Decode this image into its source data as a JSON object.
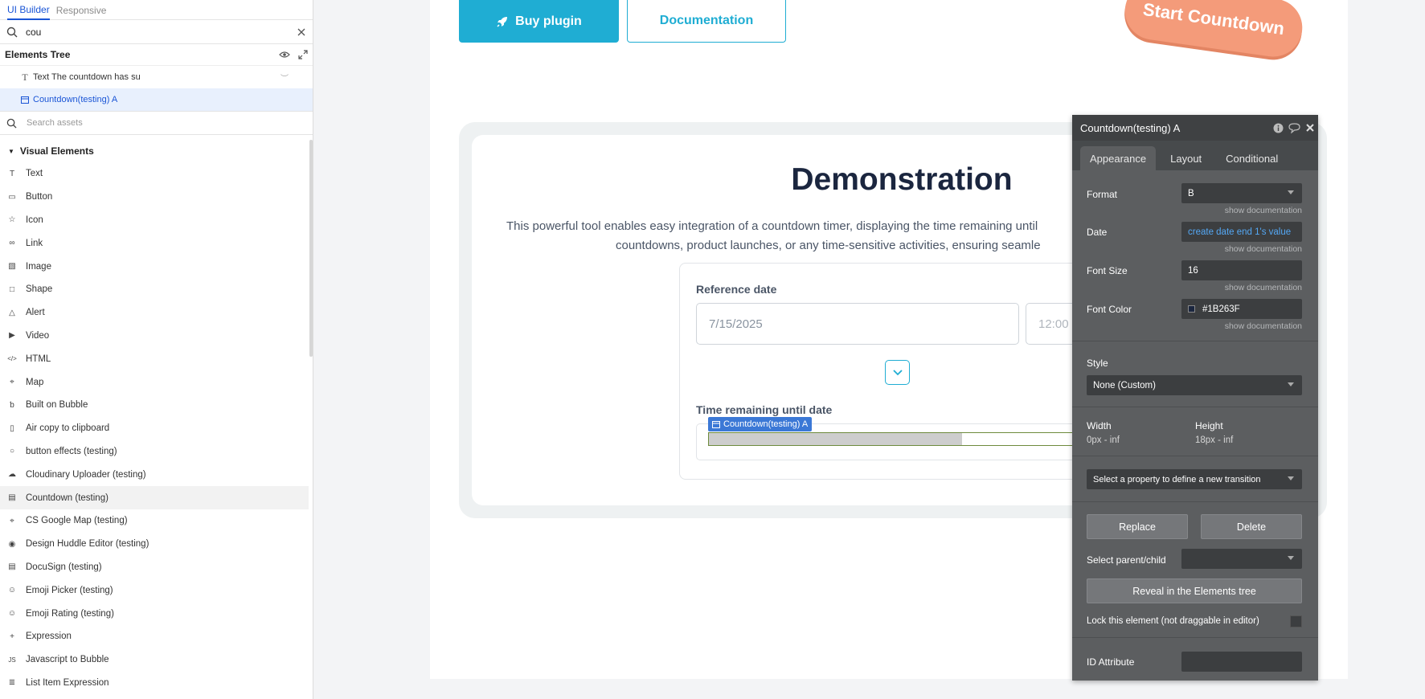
{
  "sidebar": {
    "tabs": [
      {
        "label": "UI Builder"
      },
      {
        "label": "Responsive"
      }
    ],
    "search_value": "cou",
    "tree_title": "Elements Tree",
    "tree_items": [
      {
        "label": "Text The countdown has su"
      },
      {
        "label": "Countdown(testing) A"
      }
    ],
    "assets_placeholder": "Search assets",
    "section_title": "Visual Elements",
    "elements": [
      {
        "label": "Text",
        "icon": "text-icon"
      },
      {
        "label": "Button",
        "icon": "button-icon"
      },
      {
        "label": "Icon",
        "icon": "star-icon"
      },
      {
        "label": "Link",
        "icon": "link-icon"
      },
      {
        "label": "Image",
        "icon": "image-icon"
      },
      {
        "label": "Shape",
        "icon": "shape-icon"
      },
      {
        "label": "Alert",
        "icon": "alert-icon"
      },
      {
        "label": "Video",
        "icon": "video-icon"
      },
      {
        "label": "HTML",
        "icon": "code-icon"
      },
      {
        "label": "Map",
        "icon": "map-pin-icon"
      },
      {
        "label": "Built on Bubble",
        "icon": "bubble-logo-icon"
      },
      {
        "label": "Air copy to clipboard",
        "icon": "clipboard-icon"
      },
      {
        "label": "button effects (testing)",
        "icon": "circle-icon"
      },
      {
        "label": "Cloudinary Uploader (testing)",
        "icon": "cloud-icon"
      },
      {
        "label": "Countdown (testing)",
        "icon": "calendar-icon"
      },
      {
        "label": "CS Google Map (testing)",
        "icon": "map-pin-icon"
      },
      {
        "label": "Design Huddle Editor (testing)",
        "icon": "palette-icon"
      },
      {
        "label": "DocuSign (testing)",
        "icon": "document-icon"
      },
      {
        "label": "Emoji Picker (testing)",
        "icon": "emoji-icon"
      },
      {
        "label": "Emoji Rating (testing)",
        "icon": "emoji-icon"
      },
      {
        "label": "Expression",
        "icon": "plus-icon"
      },
      {
        "label": "Javascript to Bubble",
        "icon": "js-icon"
      },
      {
        "label": "List Item Expression",
        "icon": "list-icon"
      }
    ]
  },
  "canvas": {
    "buy_label": "Buy plugin",
    "doc_label": "Documentation",
    "pill_label": "Start Countdown",
    "demo_title": "Demonstration",
    "demo_desc_1": "This powerful tool enables easy integration of a countdown timer, displaying the time remaining until",
    "demo_desc_2": "countdowns, product launches, or any time-sensitive activities, ensuring seamle",
    "ref_label": "Reference date",
    "date_value": "7/15/2025",
    "time_value": "12:00",
    "remaining_label": "Time remaining until date",
    "tag_label": "Countdown(testing) A",
    "bar_fill": 0.66
  },
  "editor": {
    "title": "Countdown(testing) A",
    "tabs": [
      {
        "label": "Appearance"
      },
      {
        "label": "Layout"
      },
      {
        "label": "Conditional"
      }
    ],
    "format_label": "Format",
    "format_value": "B",
    "date_label": "Date",
    "date_value": "create date end 1's value",
    "fontsize_label": "Font Size",
    "fontsize_value": "16",
    "fontcolor_label": "Font Color",
    "fontcolor_value": "#1B263F",
    "show_doc": "show documentation",
    "style_label": "Style",
    "style_value": "None (Custom)",
    "width_label": "Width",
    "width_value": "0px - inf",
    "height_label": "Height",
    "height_value": "18px - inf",
    "transition_placeholder": "Select a property to define a new transition",
    "replace_label": "Replace",
    "delete_label": "Delete",
    "parent_label": "Select parent/child",
    "reveal_label": "Reveal in the Elements tree",
    "lock_label": "Lock this element (not draggable in editor)",
    "id_label": "ID Attribute"
  },
  "colors": {
    "accent": "#1fadd3",
    "selection": "#1a55d6",
    "pill": "#f49b7a",
    "editor_bg": "#5c5e60",
    "text_dark": "#1b263f"
  }
}
